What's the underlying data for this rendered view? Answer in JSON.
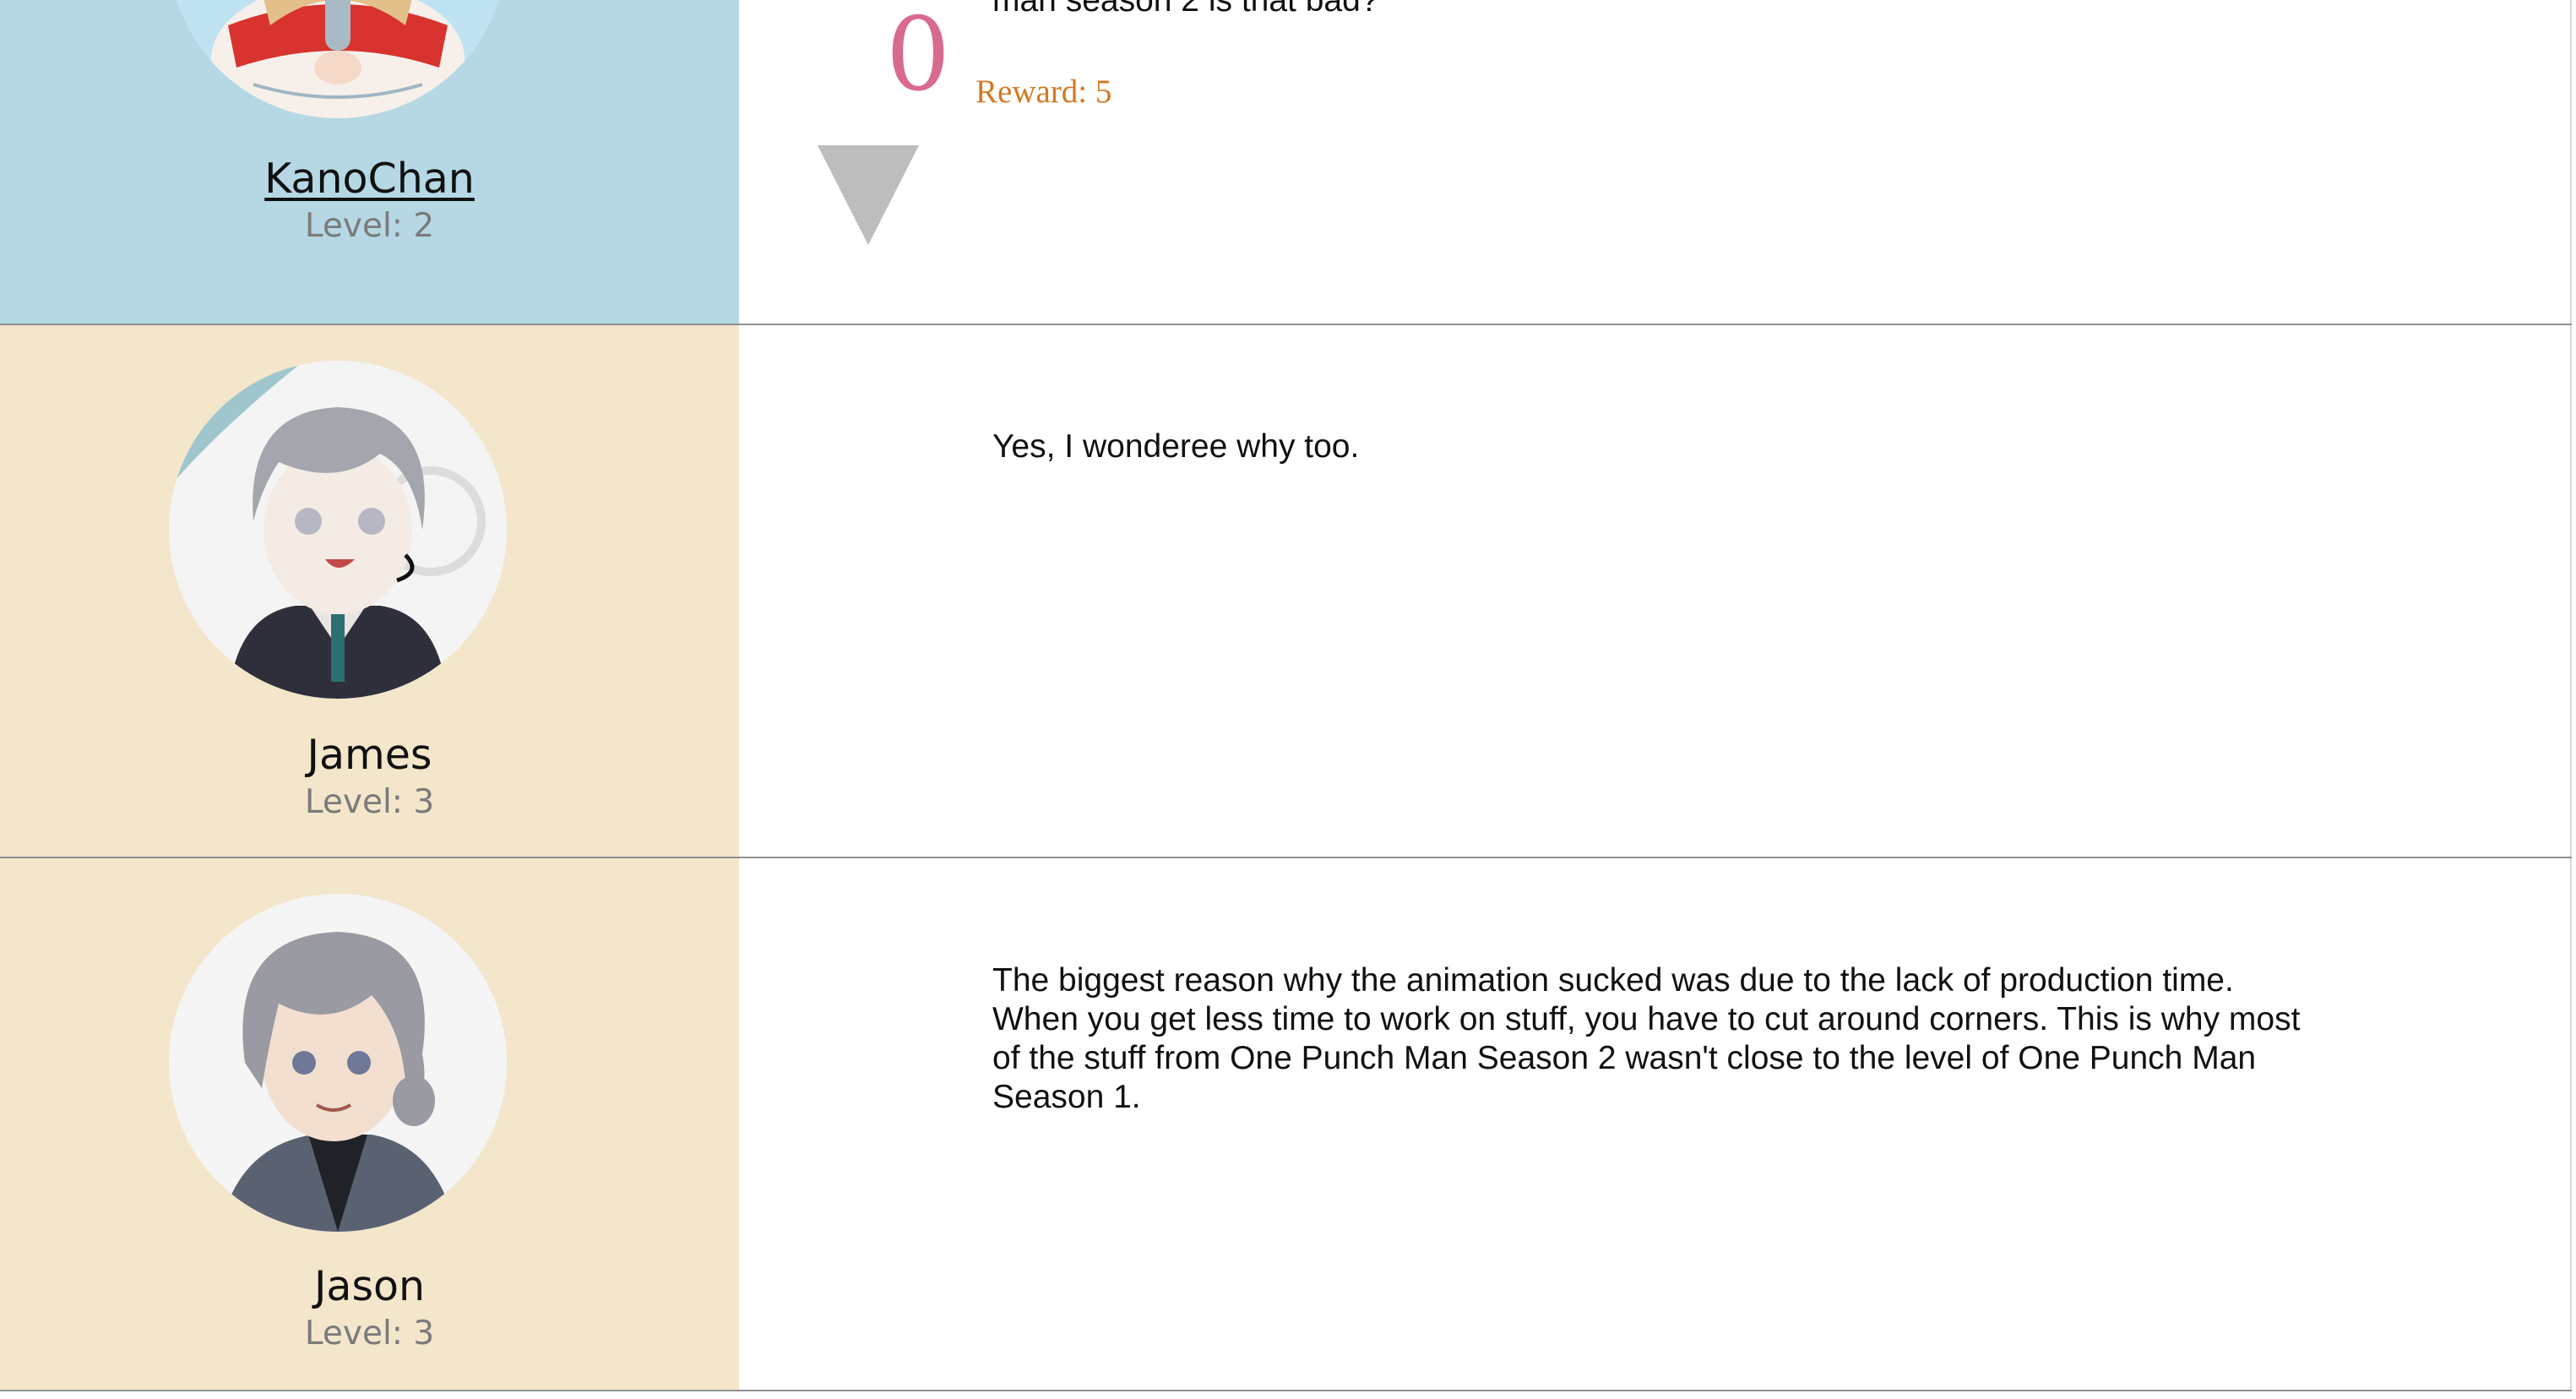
{
  "posts": [
    {
      "username": "KanoChan",
      "level": "Level: 2",
      "votes": "0",
      "reward": "Reward: 5",
      "text": "man season 2 is that bad?"
    },
    {
      "username": "James",
      "level": "Level: 3",
      "text": "Yes, I wonderee why too."
    },
    {
      "username": "Jason",
      "level": "Level: 3",
      "text": "The biggest reason why the animation sucked was due to the lack of production time. When you get less time to work on stuff, you have to cut around corners. This is why most of the stuff from One Punch Man Season 2 wasn't close to the level of One Punch Man Season 1."
    }
  ],
  "colors": {
    "op_user_bg": "#b5d8e4",
    "reply_user_bg": "#f3e6cb",
    "vote_count": "#d86a91",
    "reward": "#d27a24",
    "level": "#7b7b7b"
  },
  "icons": {
    "downvote": "downvote-triangle-icon"
  }
}
